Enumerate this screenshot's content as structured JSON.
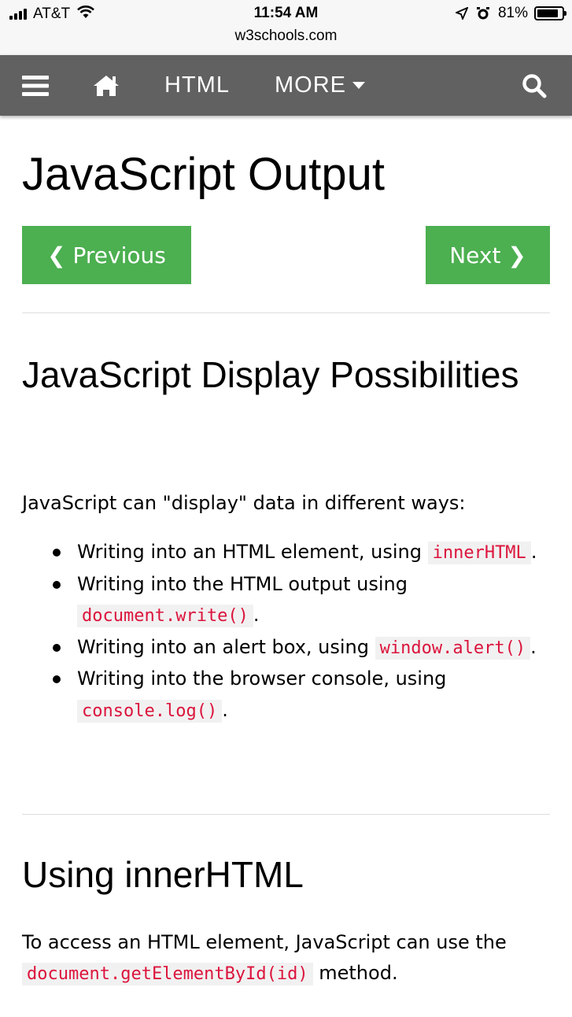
{
  "status_bar": {
    "carrier": "AT&T",
    "time": "11:54 AM",
    "url": "w3schools.com",
    "battery": "81%"
  },
  "nav": {
    "html_label": "HTML",
    "more_label": "MORE"
  },
  "page": {
    "title": "JavaScript Output",
    "previous_label": "❮ Previous",
    "next_label": "Next ❯",
    "section1": {
      "heading": "JavaScript Display Possibilities",
      "intro": "JavaScript can \"display\" data in different ways:",
      "items": [
        {
          "text": "Writing into an HTML element, using ",
          "code": "innerHTML",
          "suffix": "."
        },
        {
          "text": "Writing into the HTML output using ",
          "code": "document.write()",
          "suffix": "."
        },
        {
          "text": "Writing into an alert box, using ",
          "code": "window.alert()",
          "suffix": "."
        },
        {
          "text": "Writing into the browser console, using ",
          "code": "console.log()",
          "suffix": "."
        }
      ]
    },
    "section2": {
      "heading": "Using innerHTML",
      "para_start": "To access an HTML element, JavaScript can use the ",
      "para_code": "document.getElementById(id)",
      "para_end": " method."
    }
  }
}
